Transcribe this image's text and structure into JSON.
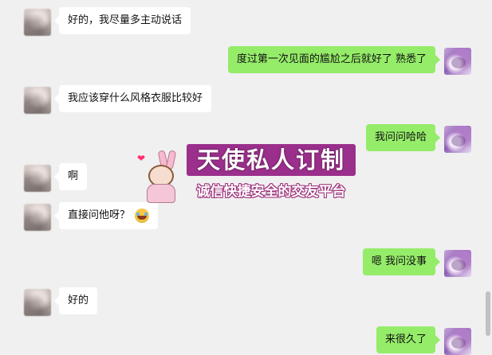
{
  "messages": [
    {
      "side": "left",
      "text": "好的，我尽量多主动说话"
    },
    {
      "side": "right",
      "text": "度过第一次见面的尴尬之后就好了 熟悉了"
    },
    {
      "side": "left",
      "text": "我应该穿什么风格衣服比较好"
    },
    {
      "side": "right",
      "text": "我问问哈哈"
    },
    {
      "side": "left",
      "text": "啊"
    },
    {
      "side": "left",
      "text": "直接问他呀？",
      "emoji": "laughing-tears-emoji"
    },
    {
      "side": "right",
      "text": "嗯 我问没事"
    },
    {
      "side": "left",
      "text": "好的"
    },
    {
      "side": "right",
      "text": "来很久了"
    }
  ],
  "watermark": {
    "title": "天使私人订制",
    "subtitle": "诚信快捷安全的交友平台"
  },
  "colors": {
    "background": "#f0f0f0",
    "incoming_bubble": "#ffffff",
    "outgoing_bubble": "#95ec69",
    "watermark_band": "#9b2f8c"
  }
}
